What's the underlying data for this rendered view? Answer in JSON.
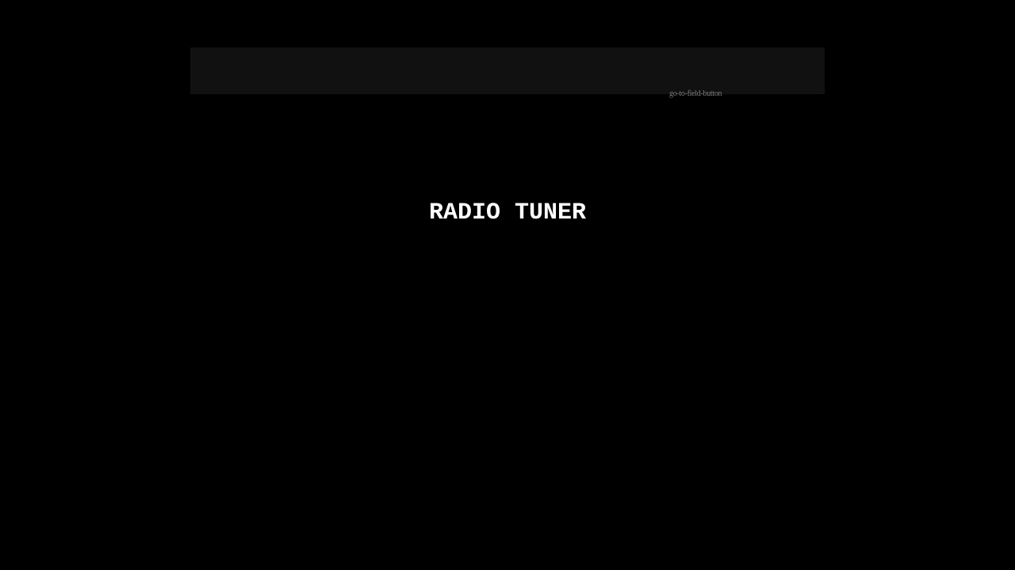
{
  "header": {
    "go_to_field_label": "go-to-field-button"
  },
  "main": {
    "title": "RADIO TUNER"
  },
  "colors": {
    "background": "#000000",
    "top_bar": "#111111",
    "title_text": "#ffffff",
    "button_text": "#7a7a7a"
  }
}
